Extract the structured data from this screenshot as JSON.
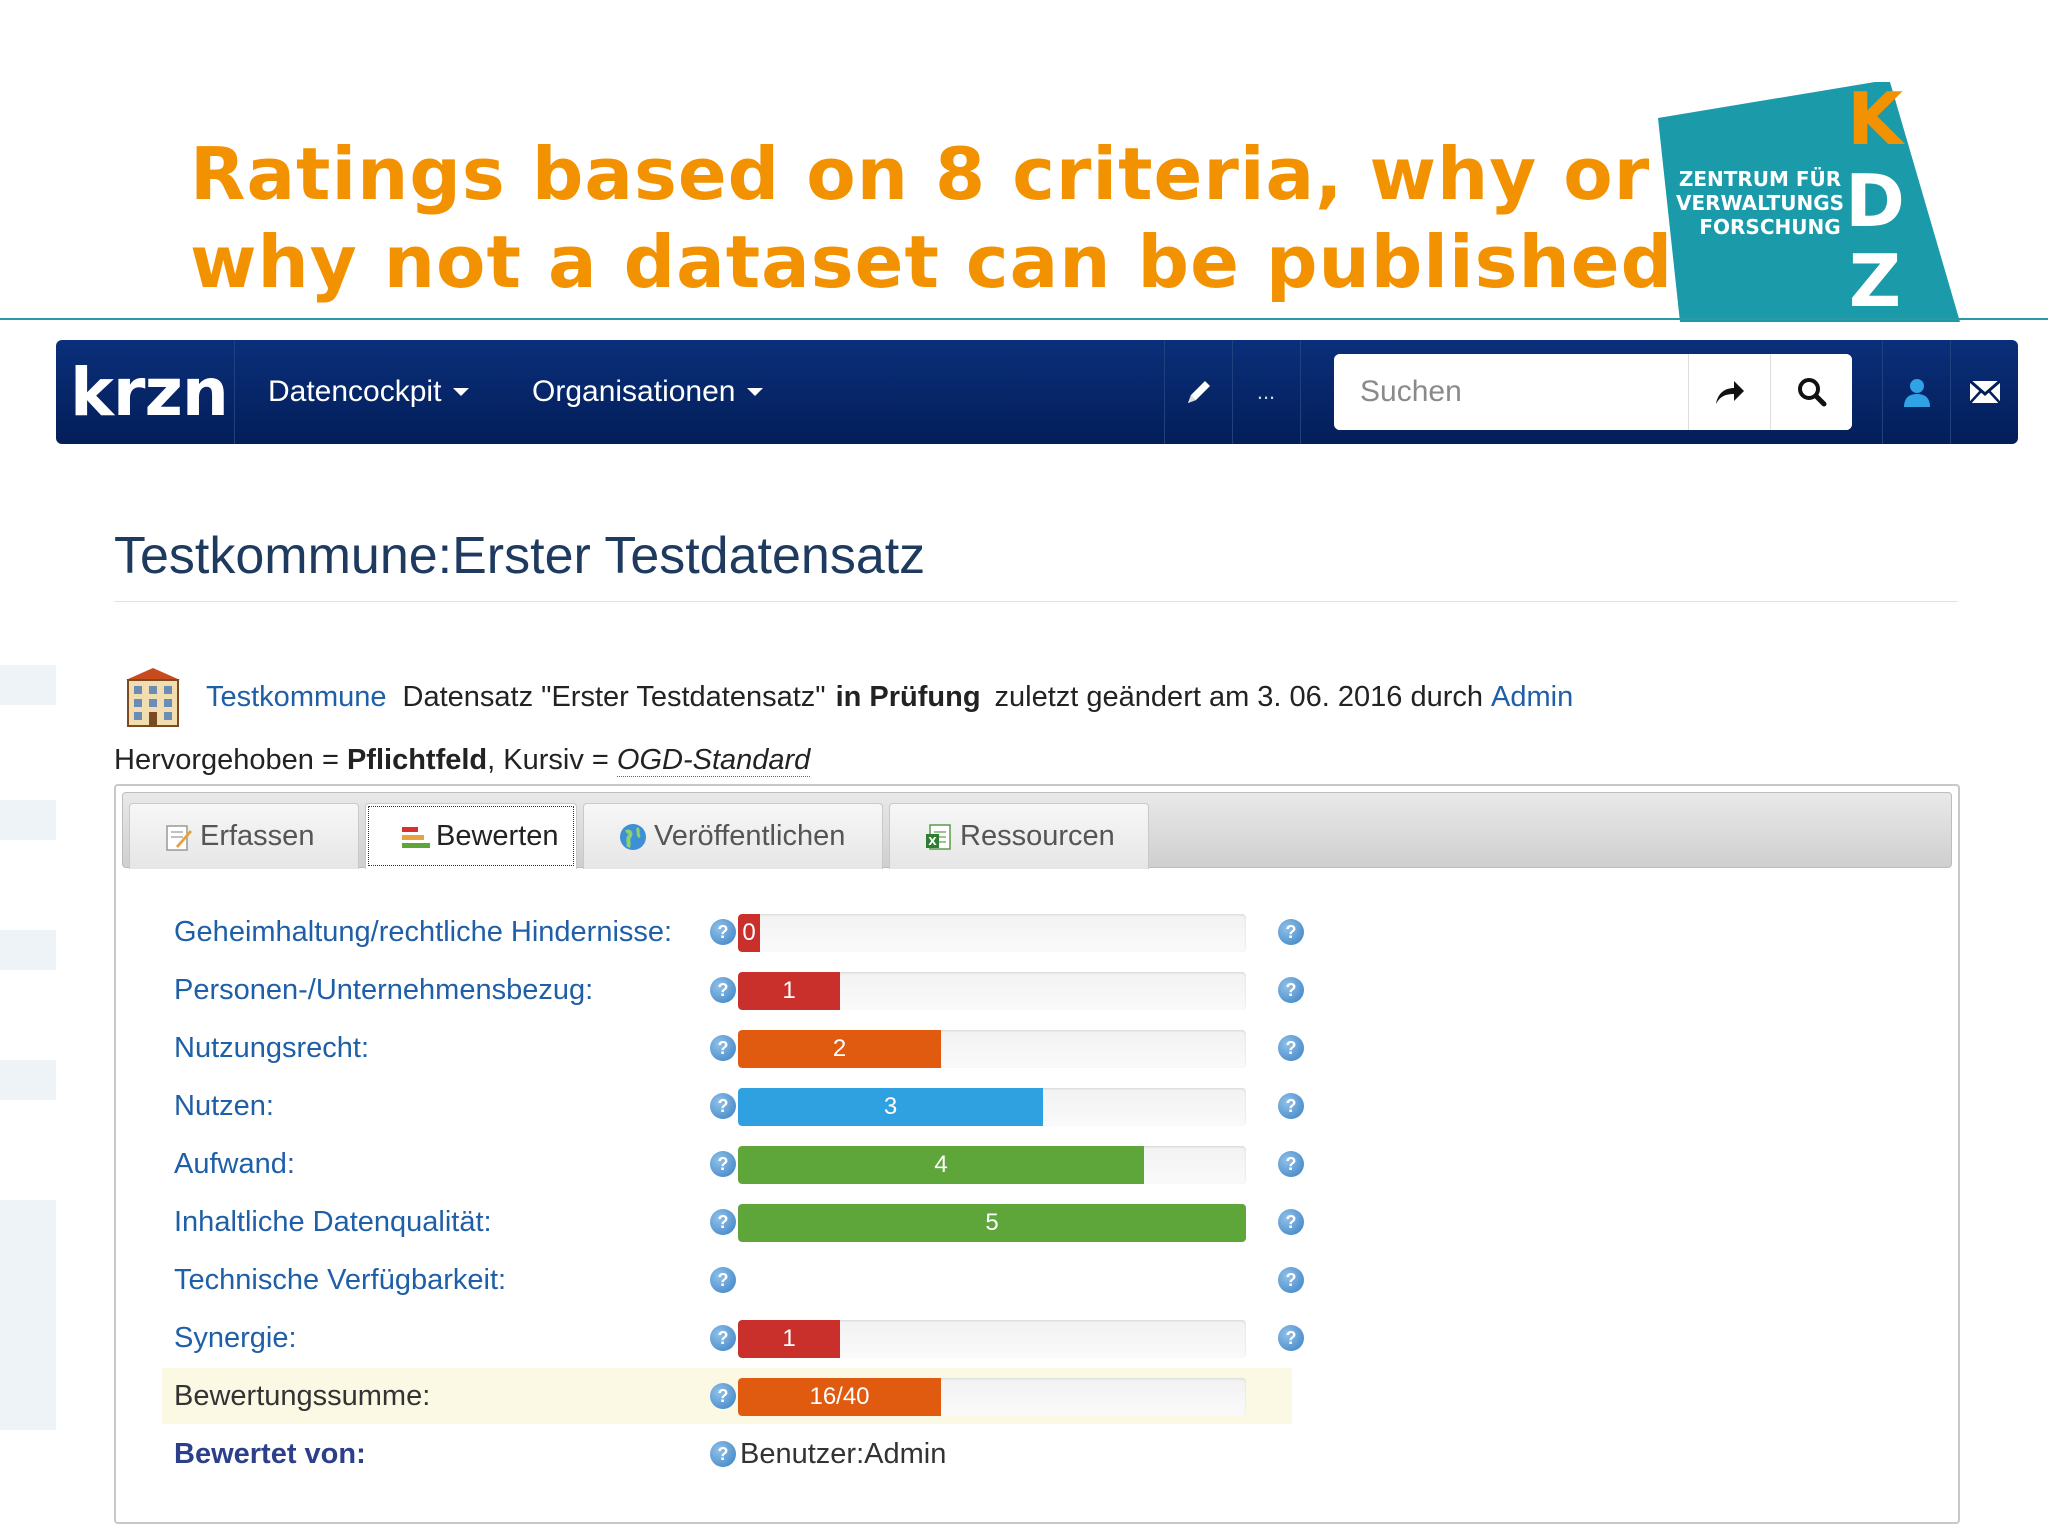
{
  "slide": {
    "title_line1": "Ratings based on 8 criteria, why or",
    "title_line2": "why not a dataset can be published",
    "logo": {
      "line1": "ZENTRUM FÜR",
      "line2": "VERWALTUNGS",
      "line3": "FORSCHUNG",
      "letters": [
        "K",
        "D",
        "Z"
      ],
      "color": "#1b9aaa"
    }
  },
  "navbar": {
    "brand": "krzn",
    "menu": [
      {
        "label": "Datencockpit"
      },
      {
        "label": "Organisationen"
      }
    ],
    "more_label": "...",
    "search_placeholder": "Suchen",
    "icons": [
      "pencil-icon",
      "go-arrow-icon",
      "search-icon",
      "user-icon",
      "envelope-icon"
    ]
  },
  "page": {
    "title": "Testkommune:Erster Testdatensatz",
    "info": {
      "org_link": "Testkommune",
      "dataset_text": "Datensatz \"Erster Testdatensatz\"",
      "status": "in Prüfung",
      "changed_text": "zuletzt geändert am 3. 06. 2016 durch",
      "user_link": "Admin"
    },
    "legend": {
      "prefix": "Hervorgehoben =",
      "bold_label": "Pflichtfeld",
      "middle": ", Kursiv =",
      "italic_label": "OGD-Standard"
    }
  },
  "tabs": [
    {
      "label": "Erfassen",
      "icon": "edit-note-icon"
    },
    {
      "label": "Bewerten",
      "icon": "rating-bars-icon",
      "active": true
    },
    {
      "label": "Veröffentlichen",
      "icon": "globe-icon"
    },
    {
      "label": "Ressourcen",
      "icon": "spreadsheet-icon"
    }
  ],
  "ratings": {
    "max_score": 5,
    "colors": {
      "0": "#c9302c",
      "1": "#c9302c",
      "2": "#e05a10",
      "3": "#2fa0e0",
      "4": "#5ea53a",
      "5": "#5ea53a"
    },
    "rows": [
      {
        "label": "Geheimhaltung/rechtliche Hindernisse:",
        "score": 0,
        "display": "0"
      },
      {
        "label": "Personen-/Unternehmensbezug:",
        "score": 1,
        "display": "1"
      },
      {
        "label": "Nutzungsrecht:",
        "score": 2,
        "display": "2"
      },
      {
        "label": "Nutzen:",
        "score": 3,
        "display": "3"
      },
      {
        "label": "Aufwand:",
        "score": 4,
        "display": "4"
      },
      {
        "label": "Inhaltliche Datenqualität:",
        "score": 5,
        "display": "5"
      },
      {
        "label": "Technische Verfügbarkeit:",
        "score": null,
        "display": ""
      },
      {
        "label": "Synergie:",
        "score": 1,
        "display": "1"
      }
    ],
    "sum": {
      "label": "Bewertungssumme:",
      "score": 16,
      "max": 40,
      "display": "16/40",
      "color": "#e05a10"
    },
    "rated_by": {
      "label": "Bewertet von:",
      "value": "Benutzer:Admin"
    }
  }
}
